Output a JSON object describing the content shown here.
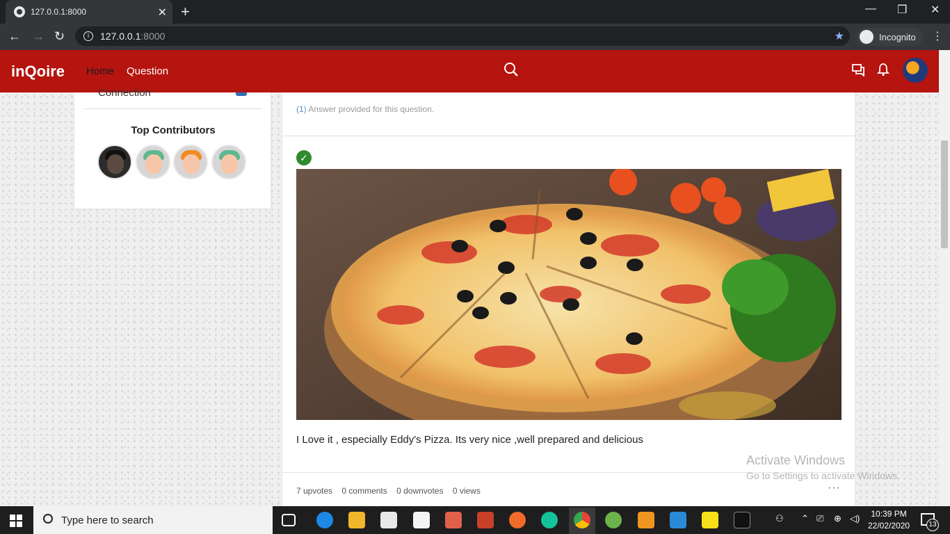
{
  "browser": {
    "tab_title": "127.0.0.1:8000",
    "url_host": "127.0.0.1",
    "url_port": ":8000",
    "profile_label": "Incognito"
  },
  "navbar": {
    "brand": "inQoire",
    "links": [
      "Home",
      "Question"
    ]
  },
  "sidebar": {
    "partial_item": "Connection",
    "top_contributors_title": "Top Contributors"
  },
  "answer": {
    "count": "(1)",
    "count_text": " Answer provided for this question.",
    "text": "I Love it , especially Eddy's Pizza. Its very nice ,well prepared and delicious",
    "upvotes": "7 upvotes",
    "comments": "0 comments",
    "downvotes": "0 downvotes",
    "views": "0 views",
    "more": "···"
  },
  "watermark": {
    "line1": "Activate Windows",
    "line2": "Go to Settings to activate Windows."
  },
  "taskbar": {
    "search_placeholder": "Type here to search",
    "time": "10:39 PM",
    "date": "22/02/2020",
    "notification_count": "13"
  },
  "colors": {
    "navbar": "#b5140f",
    "link_blue": "#5b8bd6",
    "check_green": "#2e8b2e"
  }
}
